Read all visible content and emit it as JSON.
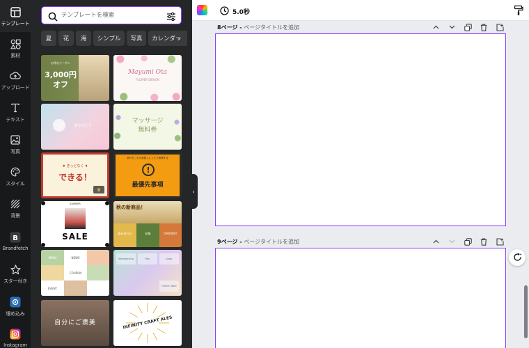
{
  "rail": {
    "items": [
      {
        "label": "テンプレート",
        "icon": "template-icon"
      },
      {
        "label": "素材",
        "icon": "elements-icon"
      },
      {
        "label": "アップロード",
        "icon": "upload-icon"
      },
      {
        "label": "テキスト",
        "icon": "text-icon"
      },
      {
        "label": "写真",
        "icon": "photo-icon"
      },
      {
        "label": "スタイル",
        "icon": "palette-icon"
      },
      {
        "label": "背景",
        "icon": "background-icon"
      },
      {
        "label": "Brandfetch",
        "icon": "brandfetch-icon"
      },
      {
        "label": "スター付き",
        "icon": "star-icon"
      },
      {
        "label": "埋め込み",
        "icon": "embed-icon"
      },
      {
        "label": "Instagram",
        "icon": "instagram-icon"
      }
    ]
  },
  "search": {
    "placeholder": "テンプレートを検索"
  },
  "chips": [
    "夏",
    "花",
    "海",
    "シンプル",
    "写真",
    "カレンダー"
  ],
  "templates": {
    "t1": {
      "big": "3,000円",
      "big2": "オフ",
      "small": "お得なクーポン"
    },
    "t2": {
      "name": "Mayumi Ota",
      "sub": "FLOWER DESIGN"
    },
    "t3": {
      "caption": "ありがとう"
    },
    "t4": {
      "title": "マッサージ",
      "title2": "無料券"
    },
    "t5": {
      "small": "♦ きっとなく ♦",
      "big": "できる！"
    },
    "t6": {
      "top": "あれもこれも後回しにしたら後悔する",
      "big": "最優先事項"
    },
    "t7": {
      "top": "SUMMER",
      "big": "SALE"
    },
    "t8": {
      "title": "秋の新商品！",
      "c1": "組み合わせ",
      "c2": "花鳥",
      "c3": "500円OFF"
    },
    "t9": {
      "a": "MENU",
      "b": "NEWS",
      "c": "COUPON",
      "d": "EVENT"
    },
    "t10": {
      "a": "Membership",
      "b": "Pay",
      "c": "Shop",
      "d": "Online Store"
    },
    "t11": {
      "text": "自分にご褒美"
    },
    "t12": {
      "text": "INFINITY CRAFT ALES"
    }
  },
  "topbar": {
    "timer": "5.0秒"
  },
  "pages": [
    {
      "num": "8ページ",
      "sep": " - ",
      "title": "ページタイトルを追加"
    },
    {
      "num": "9ページ",
      "sep": " - ",
      "title": "ページタイトルを追加"
    }
  ],
  "colors": {
    "accent": "#8b3dff",
    "rail": "#18191b",
    "panel": "#252627",
    "canvas": "#ebecf0"
  }
}
